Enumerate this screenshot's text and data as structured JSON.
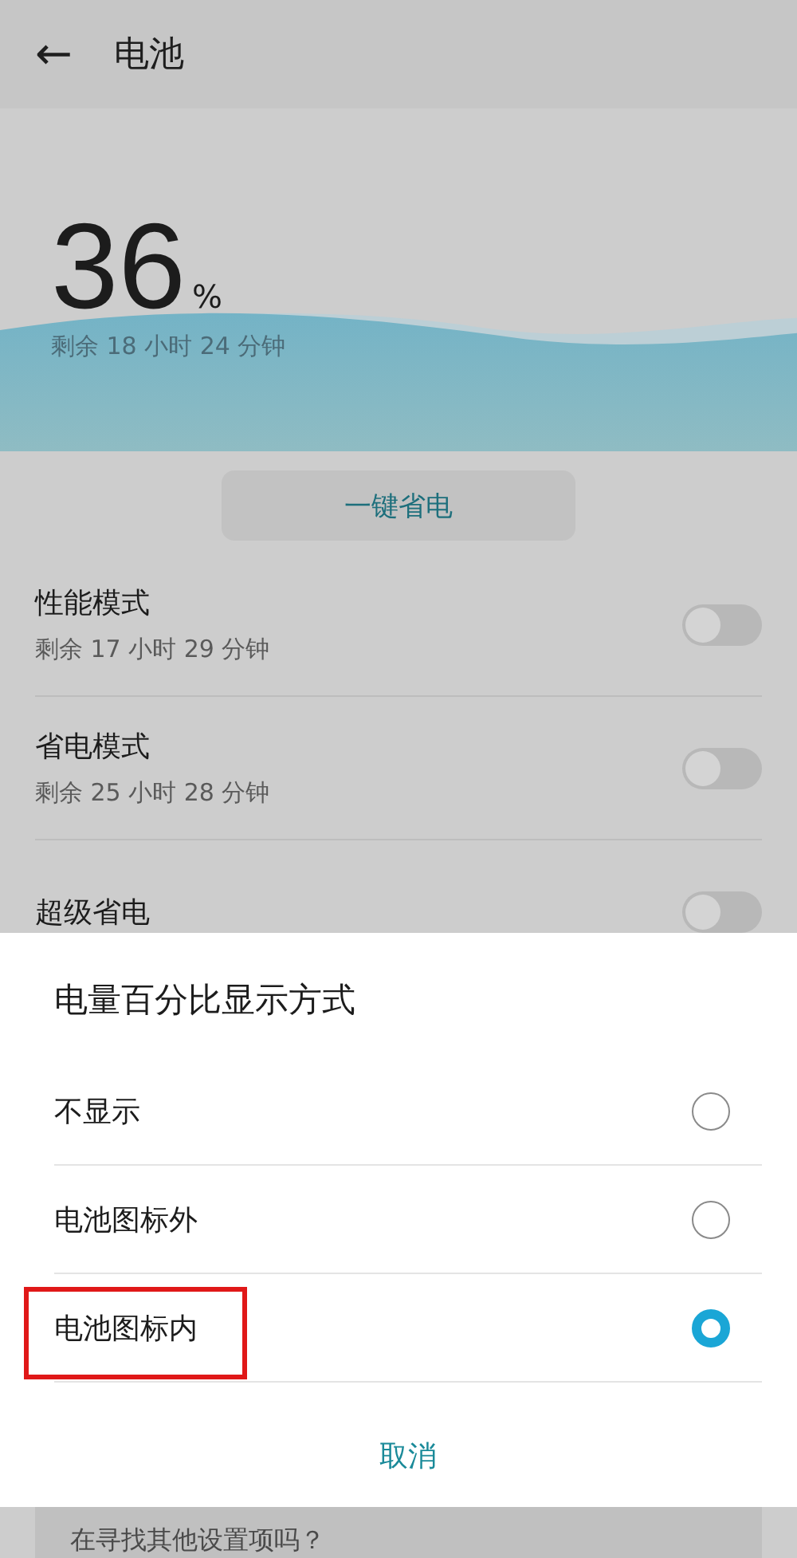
{
  "header": {
    "back": "←",
    "title": "电池"
  },
  "battery": {
    "percent": "36",
    "unit": "%",
    "remaining": "剩余 18 小时 24 分钟"
  },
  "save_button": "一键省电",
  "modes": [
    {
      "title": "性能模式",
      "subtitle": "剩余 17 小时 29 分钟",
      "on": false
    },
    {
      "title": "省电模式",
      "subtitle": "剩余 25 小时 28 分钟",
      "on": false
    },
    {
      "title": "超级省电",
      "on": false
    }
  ],
  "dialog": {
    "title": "电量百分比显示方式",
    "options": [
      {
        "label": "不显示",
        "selected": false,
        "highlighted": false
      },
      {
        "label": "电池图标外",
        "selected": false,
        "highlighted": false
      },
      {
        "label": "电池图标内",
        "selected": true,
        "highlighted": true
      }
    ],
    "cancel": "取消"
  },
  "footer": "在寻找其他设置项吗？"
}
